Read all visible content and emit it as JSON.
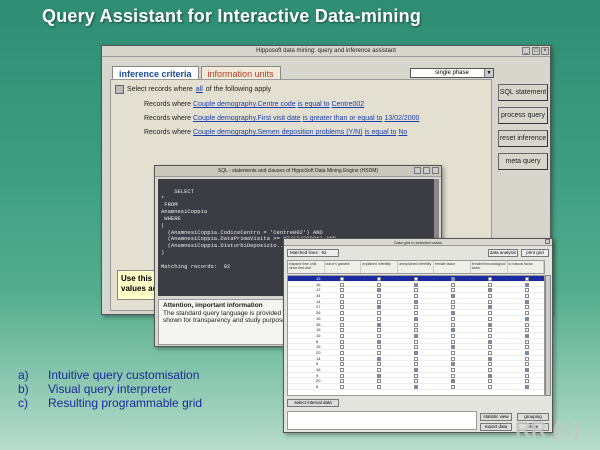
{
  "slide": {
    "title": "Query Assistant for Interactive Data-mining",
    "bullets": [
      {
        "letter": "a)",
        "text": "Intuitive query customisation"
      },
      {
        "letter": "b)",
        "text": "Visual query interpreter"
      },
      {
        "letter": "c)",
        "text": "Resulting programmable grid"
      }
    ],
    "watermark": "RR (c)"
  },
  "main_window": {
    "title": "Hipposoft data mining: query and inference assistant",
    "tabs": [
      "inference criteria",
      "information units"
    ],
    "phase_select": "single phase",
    "select_prefix": "Select records where",
    "select_link": "all",
    "select_suffix": "of the following apply",
    "records": [
      {
        "prefix": "Records where",
        "field": "Couple demography.Centre code",
        "op": "is equal to",
        "value": "Centre002"
      },
      {
        "prefix": "Records where",
        "field": "Couple demography.First visit date",
        "op": "is greater than or equal to",
        "value": "13/02/2000"
      },
      {
        "prefix": "Records where",
        "field": "Couple demography.Semen deposition problems (Y/N)",
        "op": "is equal to",
        "value": "No"
      }
    ],
    "buttons": [
      "SQL statement",
      "process query",
      "reset inference",
      "meta query"
    ],
    "tip_text": "Use this p values acc"
  },
  "sql_window": {
    "title": "SQL - statements and clauses of HippoSoft Data Mining Engine (HSDM)",
    "code": "SELECT\n*\n FROM\nAnamnesiCoppia\n WHERE\n(\n  (AnamnesiCoppia.CodiceCentro = 'Centre002') AND\n  (AnamnesiCoppia.DataPrimaVisita >= #2/13/2000#) AND\n  (AnamnesiCoppia.DisturbiDeposizio...\n)\n\nMatching records:  92",
    "attention_title": "Attention, important information",
    "attention_text": "The standard query language is provided for transfer the string on the clipboard. The con shown for transparency and study purpose."
  },
  "grid_window": {
    "title": "Data grid in selected cases",
    "matched_label": "Matched lines :",
    "matched_value": "92",
    "top_buttons": [
      "data analysis",
      "print grid"
    ],
    "headers": [
      "elapsed time until since first visit",
      "donor's gamete",
      "explained infertility",
      "unexplained infertility",
      "female factor",
      "female/immunological factor",
      "to natural factor"
    ],
    "rows": [
      "15",
      "16",
      "12",
      "34",
      "14",
      "27",
      "26",
      "19",
      "35",
      "15",
      "16",
      "8",
      "15",
      "20",
      "14",
      "8",
      "16",
      "9",
      "20",
      "8"
    ],
    "bottom_left_button": "select interval data",
    "bottom_buttons": [
      "statistic view",
      "grouping",
      "export data",
      "close"
    ]
  }
}
